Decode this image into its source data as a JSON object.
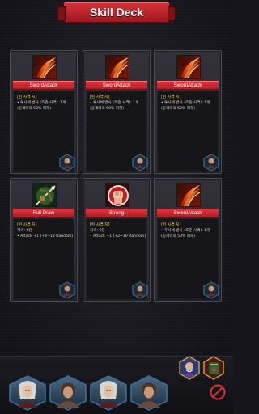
{
  "header": {
    "title": "Skill Deck"
  },
  "colors": {
    "accent_red": "#d8323a",
    "card_type_yellow": "#f0c838",
    "frame_blue": "#3b6e96"
  },
  "cards": [
    {
      "name": "SwordAttack",
      "type": "[된 사격 지]",
      "lines": [
        "• 투사체 발사 (조준 사격): 1개",
        "(공격력의 50% 피해)"
      ],
      "art_icon": "sword-slash-icon"
    },
    {
      "name": "SwordAttack",
      "type": "[된 사격 지]",
      "lines": [
        "• 투사체 발사 (조준 사격): 1개",
        "(공격력의 50% 피해)"
      ],
      "art_icon": "sword-slash-icon"
    },
    {
      "name": "SwordAttack",
      "type": "[된 사격 지]",
      "lines": [
        "• 투사체 발사 (조준 사격): 1개",
        "(공격력의 50% 피해)"
      ],
      "art_icon": "sword-slash-icon"
    },
    {
      "name": "Full Draw",
      "type": "[된 사격 지]",
      "lines": [
        "지속: 6턴",
        "• Attack +1 (+4~13 Random)"
      ],
      "art_icon": "arrow-draw-icon"
    },
    {
      "name": "Strong",
      "type": "[된 사격 지]",
      "lines": [
        "지속: 6턴",
        "• Attack +1 (+2~10 Random)"
      ],
      "art_icon": "strong-fist-icon"
    },
    {
      "name": "SwordAttack",
      "type": "[된 사격 지]",
      "lines": [
        "• 투사체 발사 (조준 사격): 1개",
        "(공격력의 50% 피해)"
      ],
      "art_icon": "sword-slash-icon"
    }
  ],
  "side_icons": [
    "wizard-portrait-icon",
    "spellbook-icon"
  ],
  "heroes": [
    "hero-elf-portrait",
    "hero-warrior-portrait",
    "hero-elf-portrait",
    "hero-warrior-portrait"
  ]
}
